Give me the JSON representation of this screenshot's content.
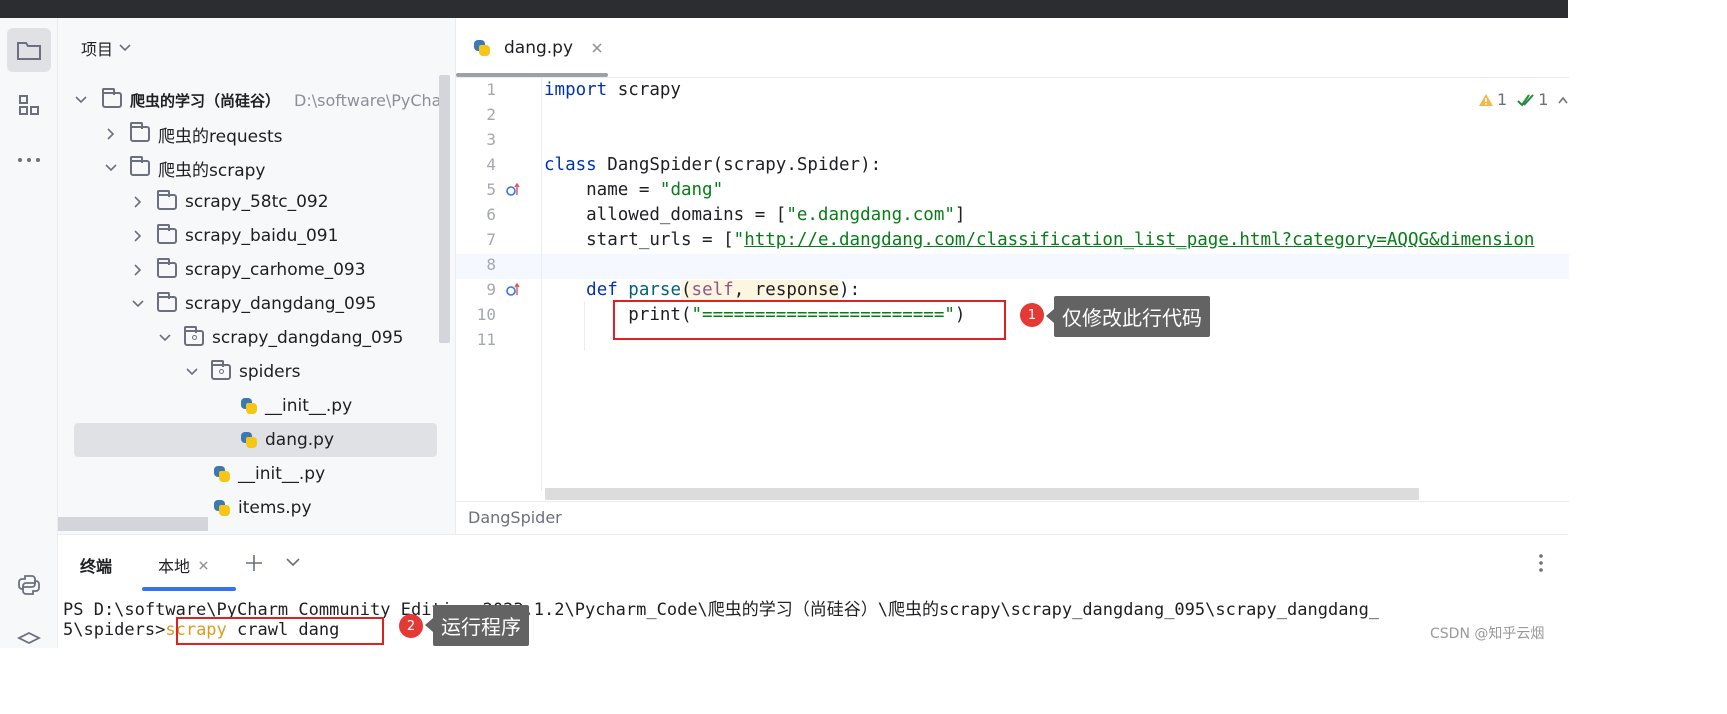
{
  "project_panel": {
    "title": "项目",
    "root": {
      "name": "爬虫的学习（尚硅谷）",
      "path": "D:\\software\\PyCha"
    },
    "items": [
      {
        "label": "爬虫的requests"
      },
      {
        "label": "爬虫的scrapy"
      },
      {
        "label": "scrapy_58tc_092"
      },
      {
        "label": "scrapy_baidu_091"
      },
      {
        "label": "scrapy_carhome_093"
      },
      {
        "label": "scrapy_dangdang_095"
      },
      {
        "label": "scrapy_dangdang_095"
      },
      {
        "label": "spiders"
      },
      {
        "label": "__init__.py"
      },
      {
        "label": "dang.py"
      },
      {
        "label": "__init__.py"
      },
      {
        "label": "items.py"
      }
    ]
  },
  "editor": {
    "tab_label": "dang.py",
    "inspections": {
      "warnings": "1",
      "checks": "1"
    },
    "line_numbers": [
      "1",
      "2",
      "3",
      "4",
      "5",
      "6",
      "7",
      "8",
      "9",
      "10",
      "11"
    ],
    "code": {
      "l1_kw": "import",
      "l1_rest": " scrapy",
      "l4_kw": "class",
      "l4_rest": " DangSpider(scrapy.Spider):",
      "l5_a": "    name = ",
      "l5_str": "\"dang\"",
      "l6_a": "    allowed_domains = [",
      "l6_str": "\"e.dangdang.com\"",
      "l6_b": "]",
      "l7_a": "    start_urls = [",
      "l7_q": "\"",
      "l7_url": "http://e.dangdang.com/classification_list_page.html?category=AQQG&dimension",
      "l9_a": "    ",
      "l9_kw": "def",
      "l9_fn": " parse",
      "l9_p1": "(",
      "l9_self": "self",
      "l9_p2": ", response",
      "l9_p3": "):",
      "l10_a": "        print(",
      "l10_str": "\"=======================\"",
      "l10_b": ")"
    },
    "breadcrumb": "DangSpider"
  },
  "annotations": {
    "badge1": "1",
    "callout1": "仅修改此行代码",
    "badge2": "2",
    "callout2": "运行程序"
  },
  "terminal": {
    "title": "终端",
    "tab_label": "本地",
    "line1": "PS D:\\software\\PyCharm Community Edition 2023.1.2\\Pycharm_Code\\爬虫的学习（尚硅谷）\\爬虫的scrapy\\scrapy_dangdang_095\\scrapy_dangdang_",
    "line2_prefix": "5\\spiders>",
    "cmd_scrapy": "scrapy",
    "cmd_rest": " crawl dang"
  },
  "watermark": "CSDN @知乎云烟"
}
